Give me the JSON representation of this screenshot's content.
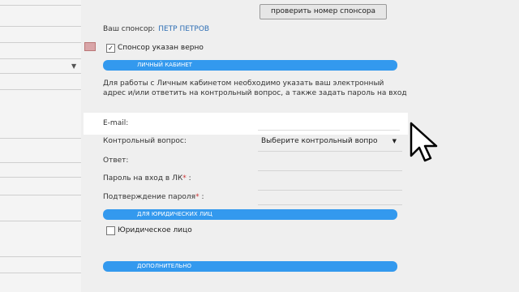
{
  "header": {
    "check_sponsor_button": "проверить номер спонсора",
    "sponsor_label": "Ваш спонсор:",
    "sponsor_name": "ПЕТР ПЕТРОВ",
    "sponsor_confirm_label": "Спонсор указан верно"
  },
  "sections": {
    "personal": "ЛИЧНЫЙ КАБИНЕТ",
    "legal": "ДЛЯ ЮРИДИЧЕСКИХ ЛИЦ",
    "extra": "ДОПОЛНИТЕЛЬНО"
  },
  "info_text": "Для работы с Личным кабинетом необходимо указать ваш электронный адрес и/или ответить на контрольный вопрос, а также задать пароль на вход",
  "form": {
    "email_label": "E-mail:",
    "question_label": "Контрольный вопрос:",
    "question_select_value": "Выберите контрольный вопро",
    "answer_label": "Ответ:",
    "password_label": "Пароль на вход в ЛК",
    "password_confirm_label": "Подтверждение пароля",
    "required_mark": "*",
    "legal_entity_label": "Юридическое лицо"
  },
  "colors": {
    "section_bar": "#3399ee",
    "sponsor_link": "#2f6fb5"
  },
  "icons": {
    "checked": "✓",
    "dropdown": "▼"
  }
}
